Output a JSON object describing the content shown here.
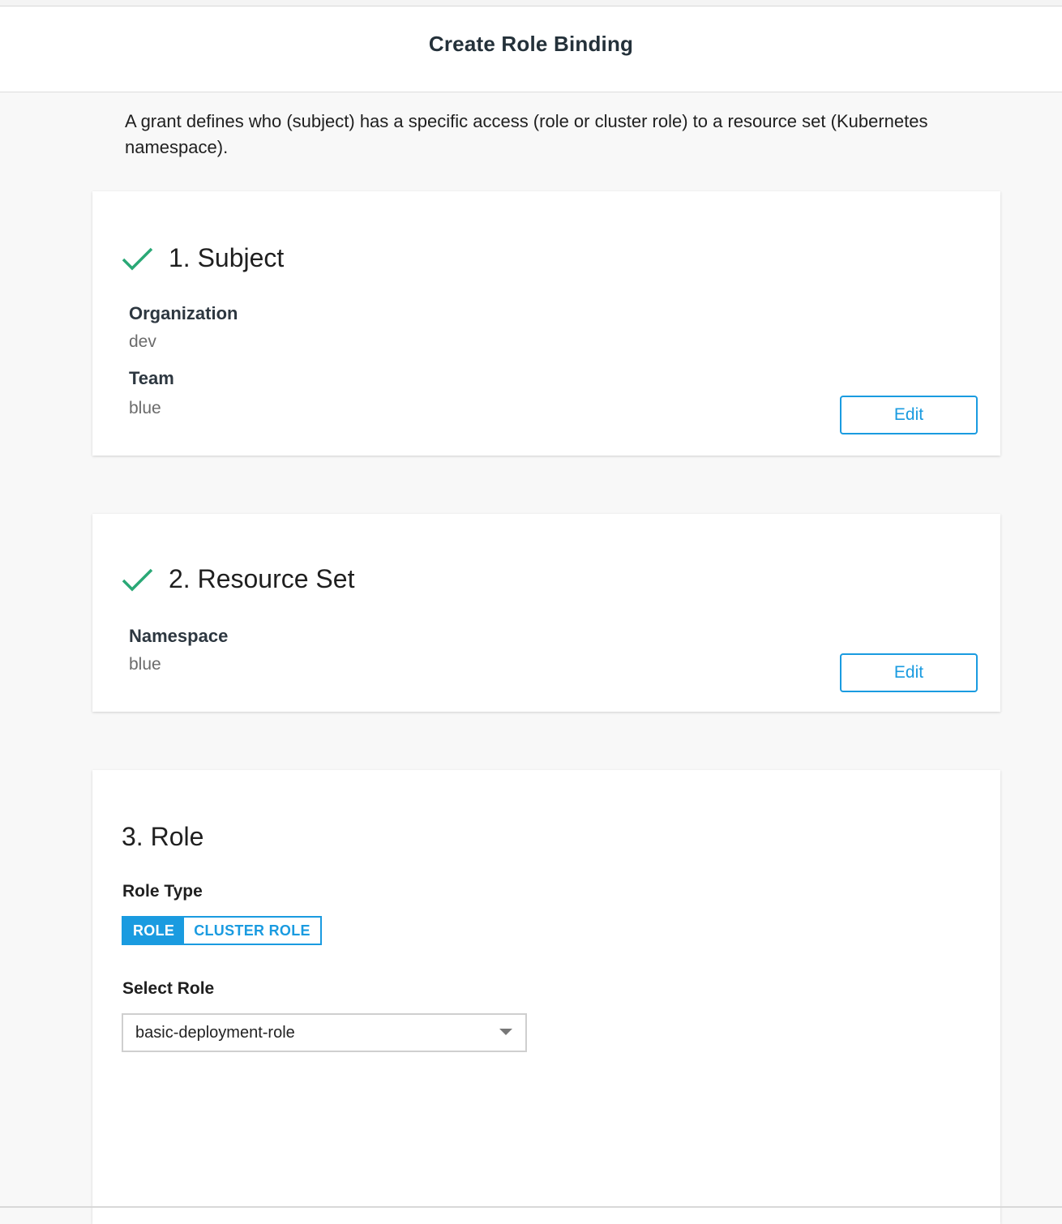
{
  "header": {
    "title": "Create Role Binding"
  },
  "intro": "A grant defines who (subject) has a specific access (role or cluster role) to a resource set (Kubernetes namespace).",
  "steps": {
    "subject": {
      "title": "1. Subject",
      "completed": true,
      "fields": [
        {
          "label": "Organization",
          "value": "dev"
        },
        {
          "label": "Team",
          "value": "blue"
        }
      ],
      "edit_label": "Edit"
    },
    "resource_set": {
      "title": "2. Resource Set",
      "completed": true,
      "fields": [
        {
          "label": "Namespace",
          "value": "blue"
        }
      ],
      "edit_label": "Edit"
    },
    "role": {
      "title": "3. Role",
      "role_type_label": "Role Type",
      "role_type_options": [
        "ROLE",
        "CLUSTER ROLE"
      ],
      "role_type_selected": "ROLE",
      "select_role_label": "Select Role",
      "select_role_value": "basic-deployment-role"
    }
  },
  "colors": {
    "accent": "#1a9be0",
    "check": "#2aa876"
  },
  "icons": {
    "check": "check-icon",
    "caret": "caret-down-icon"
  }
}
